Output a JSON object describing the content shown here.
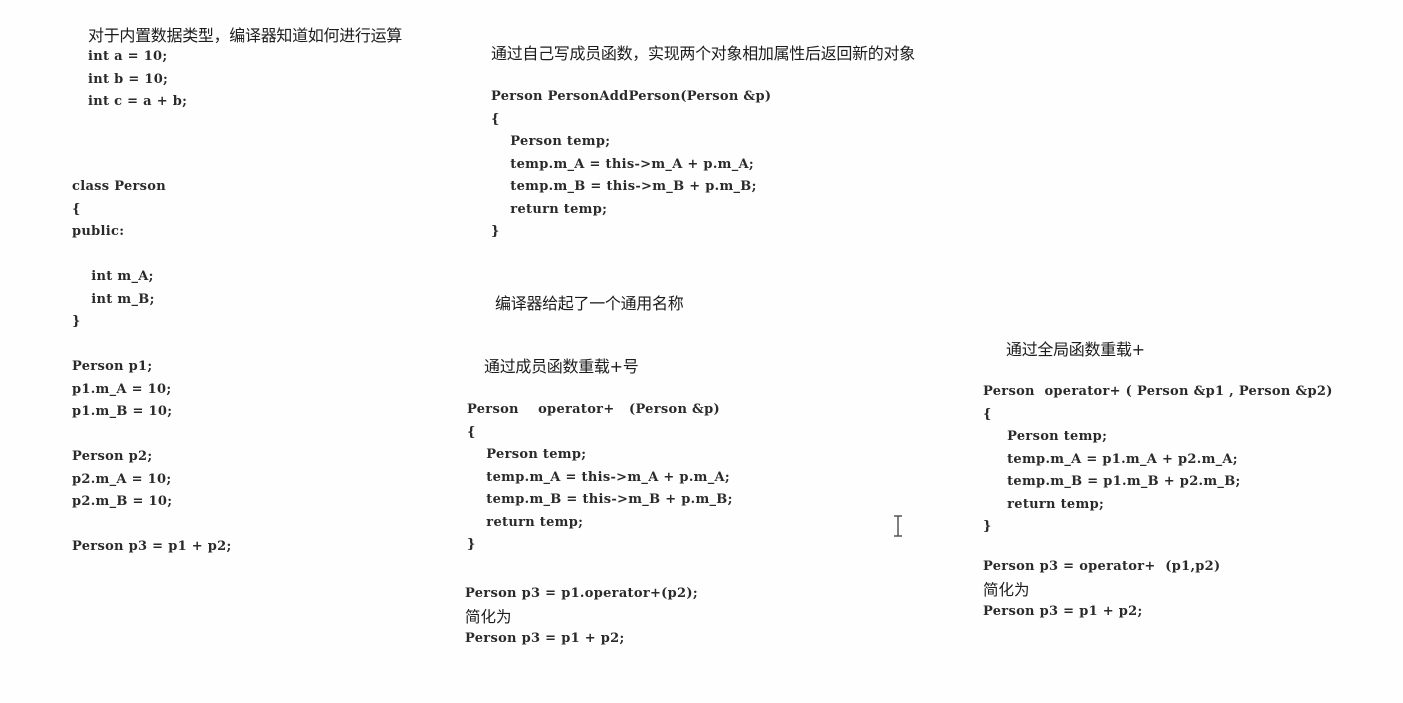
{
  "section_builtin": {
    "heading": "对于内置数据类型，编译器知道如何进行运算",
    "code": [
      "int a = 10;",
      "int b = 10;",
      "int c = a + b;"
    ]
  },
  "section_class": {
    "code": [
      "class Person",
      "{",
      "public:",
      "",
      "    int m_A;",
      "    int m_B;",
      "}",
      "",
      "Person p1;",
      "p1.m_A = 10;",
      "p1.m_B = 10;",
      "",
      "Person p2;",
      "p2.m_A = 10;",
      "p2.m_B = 10;",
      "",
      "Person p3 = p1 + p2;"
    ]
  },
  "section_member_func": {
    "heading": "通过自己写成员函数，实现两个对象相加属性后返回新的对象",
    "code": [
      "Person PersonAddPerson(Person &p)",
      "{",
      "    Person temp;",
      "    temp.m_A = this->m_A + p.m_A;",
      "    temp.m_B = this->m_B + p.m_B;",
      "    return temp;",
      "}"
    ]
  },
  "section_generic_name": {
    "heading": "编译器给起了一个通用名称"
  },
  "section_member_overload": {
    "heading": "通过成员函数重载+号",
    "code": [
      "Person    operator+   (Person &p)",
      "{",
      "    Person temp;",
      "    temp.m_A = this->m_A + p.m_A;",
      "    temp.m_B = this->m_B + p.m_B;",
      "    return temp;",
      "}"
    ],
    "usage": [
      "Person p3 = p1.operator+(p2);"
    ],
    "simplify_label": "简化为",
    "simplified": [
      "Person p3 = p1 + p2;"
    ]
  },
  "section_global_overload": {
    "heading": "通过全局函数重载+",
    "code": [
      "Person  operator+ ( Person &p1 , Person &p2)",
      "{",
      "     Person temp;",
      "     temp.m_A = p1.m_A + p2.m_A;",
      "     temp.m_B = p1.m_B + p2.m_B;",
      "     return temp;",
      "}"
    ],
    "usage": [
      "Person p3 = operator+  (p1,p2)"
    ],
    "simplify_label": "简化为",
    "simplified": [
      "Person p3 = p1 + p2;"
    ]
  },
  "cursor": {
    "icon": "text-ibeam-cursor-icon"
  }
}
